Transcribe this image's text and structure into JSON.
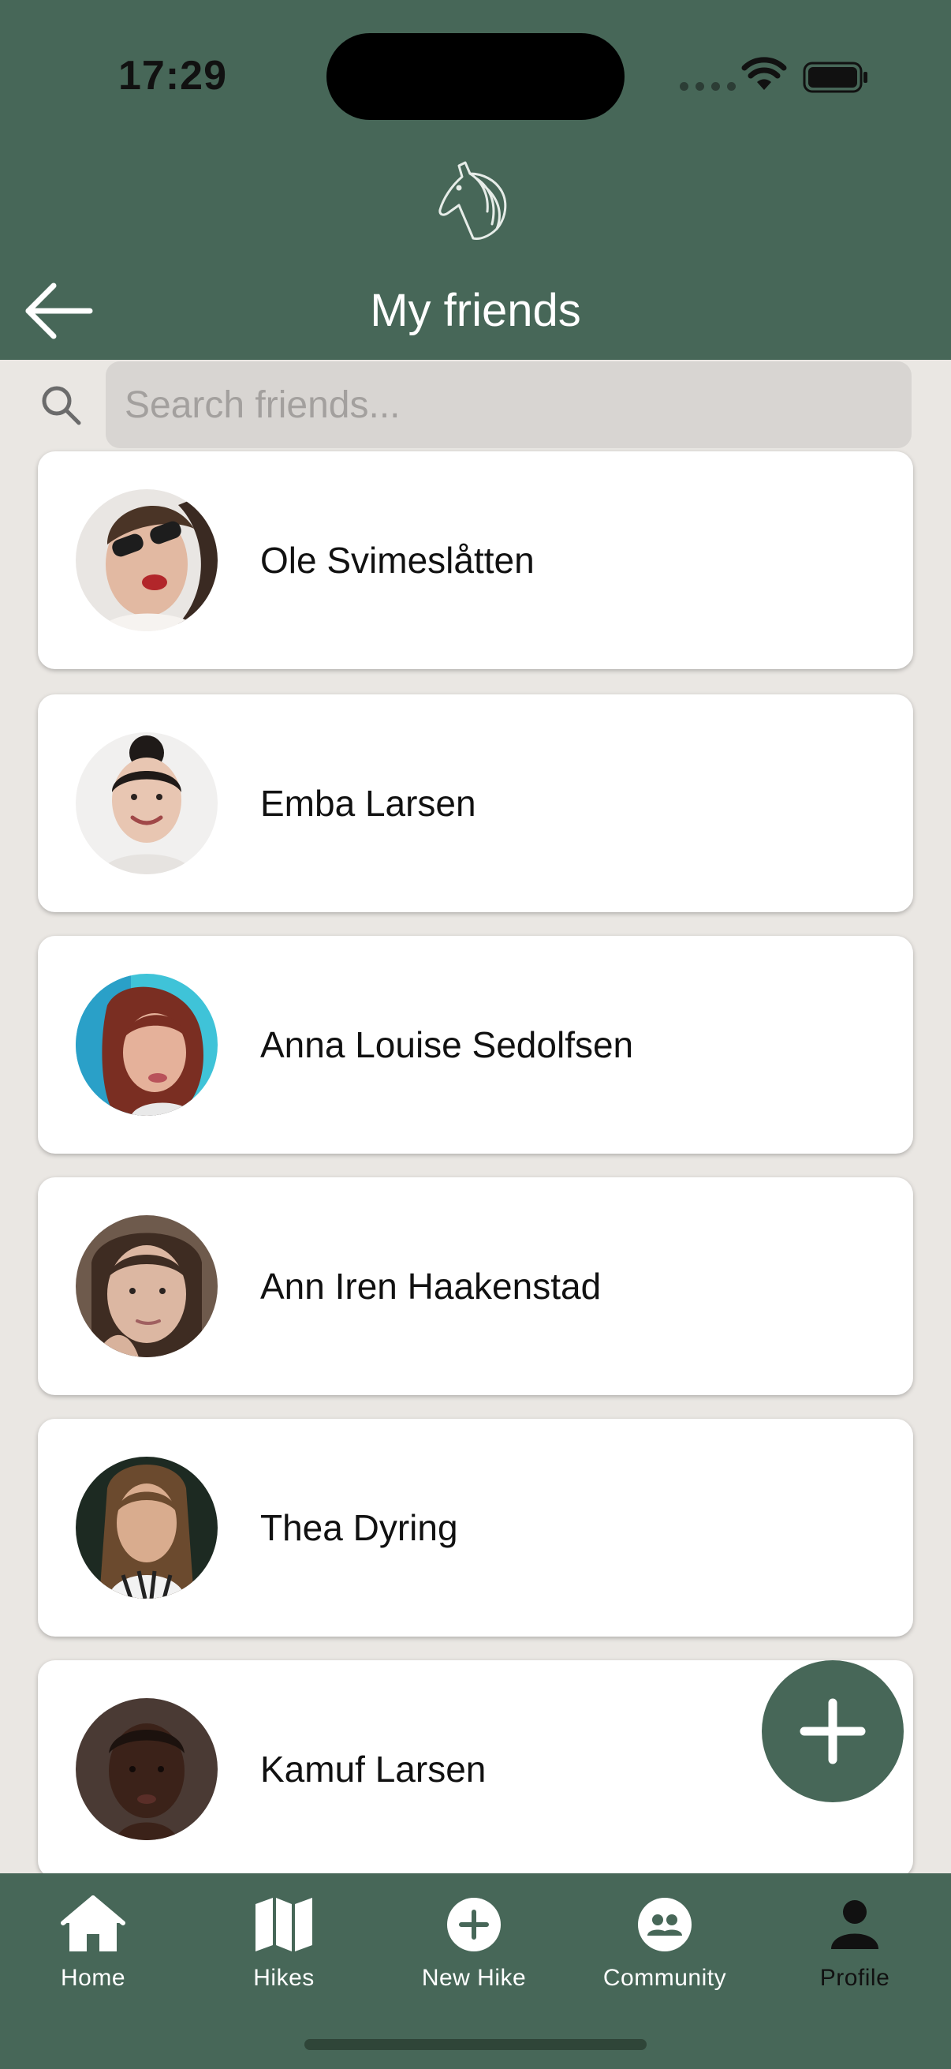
{
  "status_bar": {
    "time": "17:29"
  },
  "header": {
    "title": "My friends"
  },
  "search": {
    "placeholder": "Search friends..."
  },
  "friends": [
    {
      "name": "Ole Svimeslåtten"
    },
    {
      "name": "Emba Larsen"
    },
    {
      "name": "Anna Louise Sedolfsen"
    },
    {
      "name": "Ann Iren Haakenstad"
    },
    {
      "name": "Thea Dyring"
    },
    {
      "name": "Kamuf Larsen"
    }
  ],
  "tabbar": {
    "items": [
      {
        "label": "Home",
        "icon": "home-icon"
      },
      {
        "label": "Hikes",
        "icon": "map-icon"
      },
      {
        "label": "New Hike",
        "icon": "plus-circle-icon"
      },
      {
        "label": "Community",
        "icon": "people-icon"
      },
      {
        "label": "Profile",
        "icon": "person-icon"
      }
    ],
    "active": "Profile"
  },
  "colors": {
    "header": "#476758",
    "background": "#eae7e3",
    "card": "#ffffff",
    "accent": "#476758"
  }
}
